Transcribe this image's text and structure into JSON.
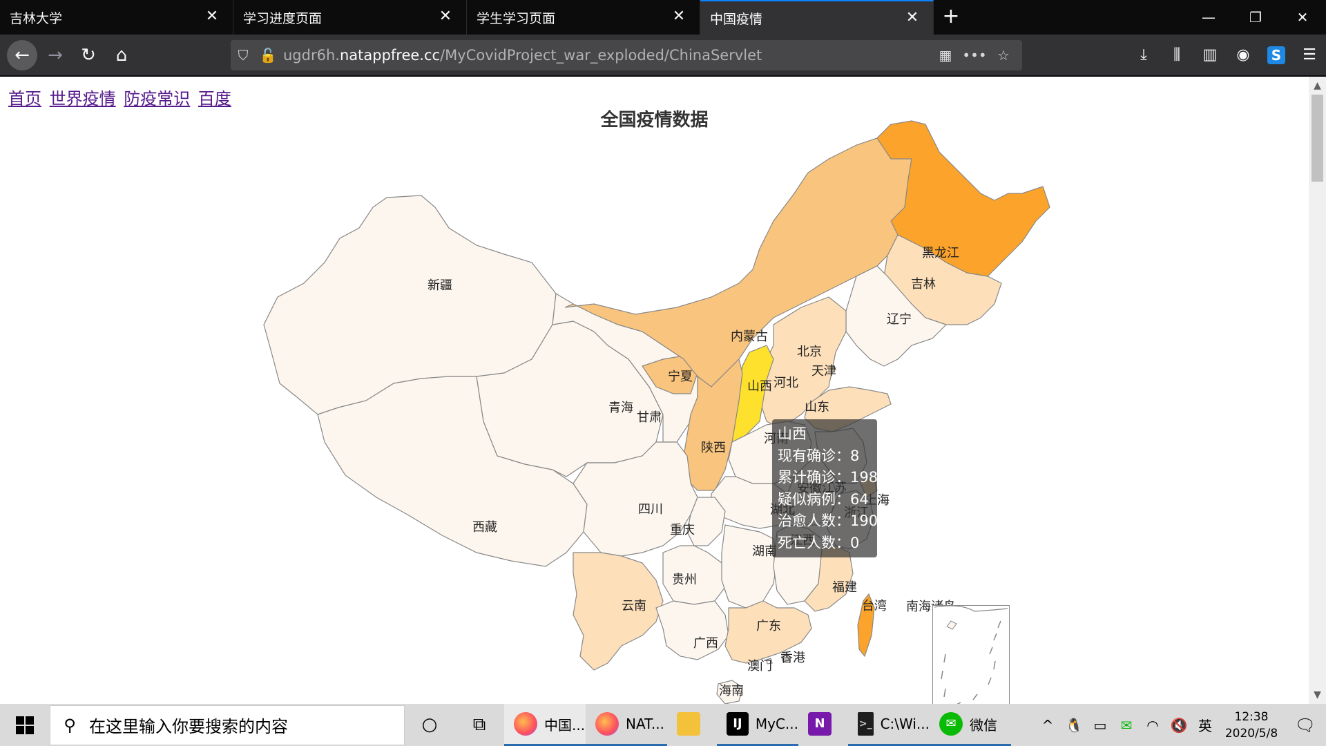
{
  "browser": {
    "tabs": [
      {
        "title": "吉林大学",
        "active": false
      },
      {
        "title": "学习进度页面",
        "active": false
      },
      {
        "title": "学生学习页面",
        "active": false
      },
      {
        "title": "中国疫情",
        "active": true
      }
    ],
    "new_tab_glyph": "+",
    "window_controls": {
      "minimize": "—",
      "restore": "❐",
      "close": "✕"
    },
    "url": {
      "prefix": "ugdr6h.",
      "host": "natappfree.cc",
      "path": "/MyCovidProject_war_exploded/ChinaServlet"
    }
  },
  "page": {
    "nav_links": [
      "首页",
      "世界疫情",
      "防疫常识",
      "百度"
    ],
    "title": "全国疫情数据"
  },
  "map": {
    "colors": {
      "level0": "#fcf6ee",
      "level1": "#fde0ba",
      "level2": "#f9c47d",
      "level3": "#fba32a",
      "highlight": "#fde12c"
    },
    "provinces": [
      {
        "name": "新疆",
        "level": "level0"
      },
      {
        "name": "西藏",
        "level": "level0"
      },
      {
        "name": "青海",
        "level": "level0"
      },
      {
        "name": "甘肃",
        "level": "level0"
      },
      {
        "name": "宁夏",
        "level": "level2"
      },
      {
        "name": "内蒙古",
        "level": "level2"
      },
      {
        "name": "黑龙江",
        "level": "level3"
      },
      {
        "name": "吉林",
        "level": "level1"
      },
      {
        "name": "辽宁",
        "level": "level0"
      },
      {
        "name": "北京",
        "level": "level2"
      },
      {
        "name": "天津",
        "level": "level1"
      },
      {
        "name": "河北",
        "level": "level1"
      },
      {
        "name": "山西",
        "level": "highlight"
      },
      {
        "name": "陕西",
        "level": "level2"
      },
      {
        "name": "山东",
        "level": "level1"
      },
      {
        "name": "河南",
        "level": "level0"
      },
      {
        "name": "江苏",
        "level": "level0"
      },
      {
        "name": "安徽",
        "level": "level0"
      },
      {
        "name": "上海",
        "level": "level1"
      },
      {
        "name": "浙江",
        "level": "level0"
      },
      {
        "name": "湖北",
        "level": "level0"
      },
      {
        "name": "四川",
        "level": "level0"
      },
      {
        "name": "重庆",
        "level": "level0"
      },
      {
        "name": "贵州",
        "level": "level0"
      },
      {
        "name": "湖南",
        "level": "level0"
      },
      {
        "name": "江西",
        "level": "level0"
      },
      {
        "name": "福建",
        "level": "level1"
      },
      {
        "name": "云南",
        "level": "level1"
      },
      {
        "name": "广西",
        "level": "level0"
      },
      {
        "name": "广东",
        "level": "level1"
      },
      {
        "name": "台湾",
        "level": "level3"
      },
      {
        "name": "香港",
        "level": "level0"
      },
      {
        "name": "澳门",
        "level": "level0"
      },
      {
        "name": "海南",
        "level": "level0"
      },
      {
        "name": "南海诸岛",
        "level": "level0"
      }
    ],
    "tooltip": {
      "province": "山西",
      "rows": [
        "现有确诊：8",
        "累计确诊：198",
        "疑似病例：64",
        "治愈人数：190",
        "死亡人数：0"
      ]
    }
  },
  "taskbar": {
    "search_placeholder": "在这里输入你要搜索的内容",
    "apps": [
      {
        "label": "中国...",
        "icon": "firefox-icon",
        "state": "active"
      },
      {
        "label": "NAT...",
        "icon": "firefox-icon",
        "state": "open"
      },
      {
        "label": "",
        "icon": "folder-icon",
        "state": "pinned"
      },
      {
        "label": "MyC...",
        "icon": "intellij-icon",
        "state": "open"
      },
      {
        "label": "",
        "icon": "onenote-icon",
        "state": "pinned"
      },
      {
        "label": "C:\\Wi...",
        "icon": "cmd-icon",
        "state": "open"
      },
      {
        "label": "微信",
        "icon": "wechat-icon",
        "state": "open"
      }
    ],
    "ime": "英",
    "time": "12:38",
    "date": "2020/5/8"
  }
}
